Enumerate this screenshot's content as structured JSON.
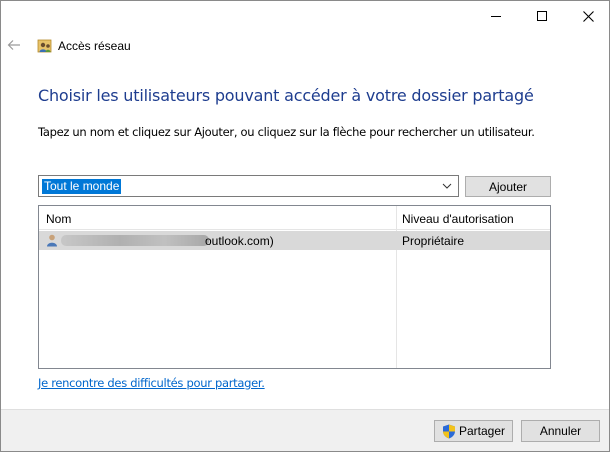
{
  "window": {
    "title": "Accès réseau",
    "controls": {
      "minimize": "minimize",
      "maximize": "maximize",
      "close": "close"
    }
  },
  "heading": "Choisir les utilisateurs pouvant accéder à votre dossier partagé",
  "instruction": "Tapez un nom et cliquez sur Ajouter, ou cliquez sur la flèche pour rechercher un utilisateur.",
  "combo": {
    "value": "Tout le monde"
  },
  "add_button": "Ajouter",
  "list": {
    "columns": [
      "Nom",
      "Niveau d'autorisation"
    ],
    "rows": [
      {
        "name_visible_suffix": "outlook.com)",
        "level": "Propriétaire"
      }
    ]
  },
  "help_link": "Je rencontre des difficultés pour partager.",
  "footer": {
    "share_button": "Partager",
    "cancel_button": "Annuler"
  },
  "colors": {
    "heading": "#1e3d8f",
    "selection": "#0078d7",
    "link": "#0066cc",
    "row_highlight": "#d9d9d9"
  },
  "icons": [
    "back-arrow-icon",
    "network-users-icon",
    "chevron-down-icon",
    "user-icon",
    "uac-shield-icon"
  ]
}
